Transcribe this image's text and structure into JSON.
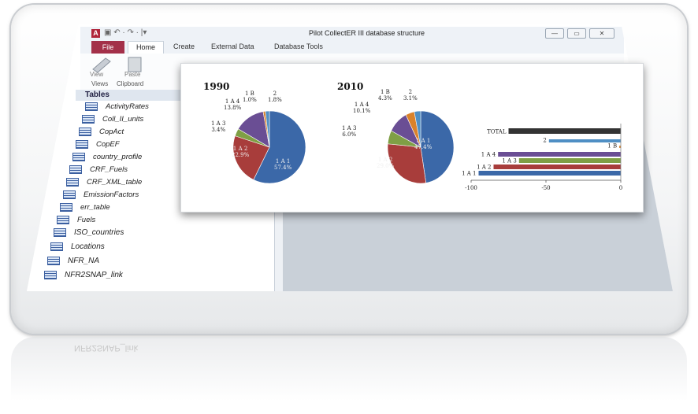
{
  "window": {
    "title": "Pilot CollectER III database structure",
    "app_logo": "A",
    "qat": "▣ ↶ · ↷ · |▾",
    "buttons": [
      "—",
      "▭",
      "✕"
    ]
  },
  "ribbon": {
    "tabs": [
      "File",
      "Home",
      "Create",
      "External Data",
      "Database Tools"
    ],
    "buttons": {
      "view": "View",
      "paste": "Paste"
    },
    "groups": {
      "views": "Views",
      "clipboard": "Clipboard"
    }
  },
  "nav": {
    "header": "Tables",
    "items": [
      "ActivityRates",
      "Coll_II_units",
      "CopAct",
      "CopEF",
      "country_profile",
      "CRF_Fuels",
      "CRF_XML_table",
      "EmissionFactors",
      "err_table",
      "Fuels",
      "ISO_countries",
      "Locations",
      "NFR_NA",
      "NFR2SNAP_link"
    ]
  },
  "reflection_text": "NFR2SNAP_link",
  "chart_data": [
    {
      "type": "pie",
      "title": "1990",
      "categories": [
        "1 A 1",
        "1 A 2",
        "1 A 3",
        "1 A 4",
        "1 B",
        "2"
      ],
      "values": [
        57.4,
        22.9,
        3.4,
        13.8,
        1.0,
        1.8
      ],
      "value_labels": [
        "57.4%",
        "22.9%",
        "3.4%",
        "13.8%",
        "1.0%",
        "1.8%"
      ],
      "colors": [
        "#3b68a8",
        "#a83d3b",
        "#7f9f45",
        "#6a4e94",
        "#d9822b",
        "#4f8fc4"
      ]
    },
    {
      "type": "pie",
      "title": "2010",
      "categories": [
        "1 A 1",
        "1 A 2",
        "1 A 3",
        "1 A 4",
        "1 B",
        "2"
      ],
      "values": [
        47.4,
        29.0,
        6.0,
        10.1,
        4.3,
        3.1
      ],
      "value_labels": [
        "47.4%",
        "29.0%",
        "6.0%",
        "10.1%",
        "4.3%",
        "3.1%"
      ],
      "colors": [
        "#3b68a8",
        "#a83d3b",
        "#7f9f45",
        "#6a4e94",
        "#d9822b",
        "#4f8fc4"
      ]
    },
    {
      "type": "bar",
      "orientation": "horizontal",
      "categories": [
        "TOTAL",
        "2",
        "1 B",
        "1 A 4",
        "1 A 3",
        "1 A 2",
        "1 A 1"
      ],
      "values": [
        -75,
        -48,
        -1,
        -82,
        -68,
        -85,
        -95
      ],
      "colors": [
        "#333333",
        "#4f8fc4",
        "#d9822b",
        "#6a4e94",
        "#7f9f45",
        "#a83d3b",
        "#3b68a8"
      ],
      "xlim": [
        -100,
        0
      ],
      "ticks": [
        "-100",
        "-50",
        "0"
      ]
    }
  ]
}
